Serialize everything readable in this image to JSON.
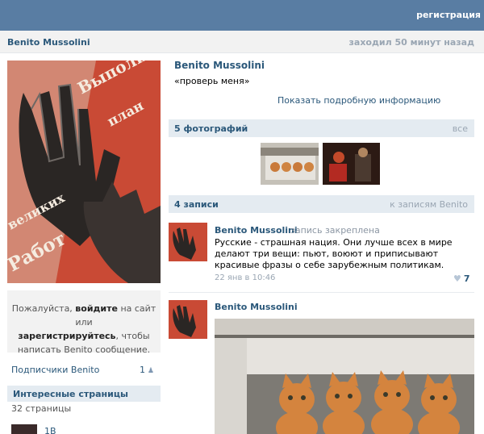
{
  "header": {
    "register_label": "регистрация"
  },
  "profile": {
    "name": "Benito Mussolini",
    "last_seen": "заходил 50 минут назад",
    "status": "«проверь меня»",
    "more_info_label": "Показать подробную информацию"
  },
  "poster_text": {
    "line1": "Выполним",
    "line2": "план",
    "line3": "великих",
    "line4": "Работ"
  },
  "login_prompt": {
    "part1": "Пожалуйста, ",
    "login": "войдите",
    "part2": " на сайт или ",
    "register": "зарегистрируйтесь",
    "part3": ", чтобы написать Benito сообщение."
  },
  "subscribers": {
    "label": "Подписчики Benito",
    "count": "1"
  },
  "interesting_pages": {
    "title": "Интересные страницы",
    "count_label": "32 страницы",
    "first_page": "1B"
  },
  "photos": {
    "title": "5 фотографий",
    "all_label": "все"
  },
  "wall": {
    "title": "4 записи",
    "link_label": "к записям Benito"
  },
  "posts": [
    {
      "author": "Benito Mussolini",
      "pinned": "запись закреплена",
      "text": "Русские - страшная нация. Они лучше всех в мире делают три вещи: пьют, воюют и приписывают красивые фразы о себе зарубежным политикам.",
      "date": "22 янв в 10:46",
      "likes": "7"
    },
    {
      "author": "Benito Mussolini"
    }
  ],
  "colors": {
    "header_blue": "#597da3",
    "link": "#2b587a",
    "section_bg": "#e4ebf1",
    "poster_red": "#c94a35"
  },
  "icons": {
    "like": "heart-icon",
    "subscribers": "people-icon"
  }
}
